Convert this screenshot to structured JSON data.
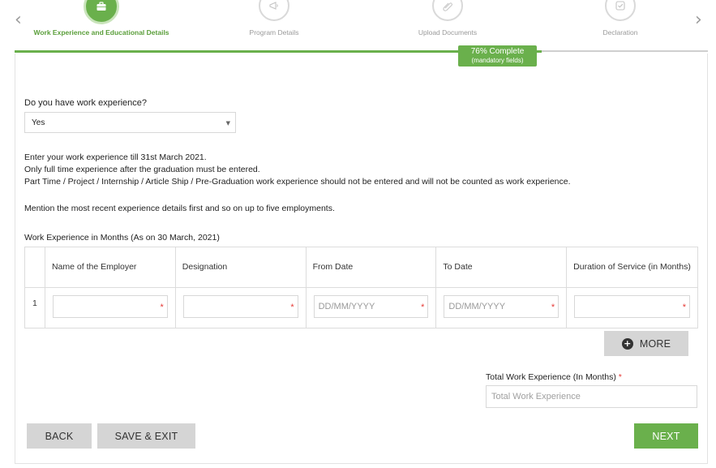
{
  "stepper": {
    "steps": [
      {
        "label": "Work Experience and Educational Details",
        "icon": "briefcase-icon",
        "active": true
      },
      {
        "label": "Program Details",
        "icon": "megaphone-icon",
        "active": false
      },
      {
        "label": "Upload Documents",
        "icon": "paperclip-icon",
        "active": false
      },
      {
        "label": "Declaration",
        "icon": "check-badge-icon",
        "active": false
      }
    ],
    "progress_percent": 76,
    "progress_label": "76% Complete",
    "progress_sub": "(mandatory fields)",
    "prev_arrow": "‹",
    "next_arrow": "›"
  },
  "form": {
    "question": "Do you have work experience?",
    "answer": "Yes",
    "caret": "▼",
    "info_lines": [
      "Enter your work experience till 31st March 2021.",
      "Only full time experience after the graduation must be entered.",
      "Part Time / Project / Internship / Article Ship / Pre-Graduation work experience should not be entered and will not be counted as work experience."
    ],
    "mention": "Mention the most recent experience details first and so on up to five employments.",
    "table_title": "Work Experience in Months (As on 30 March, 2021)",
    "columns": [
      "Name of the Employer",
      "Designation",
      "From Date",
      "To Date",
      "Duration of Service (in Months)"
    ],
    "rows": [
      {
        "num": "1",
        "from_placeholder": "DD/MM/YYYY",
        "to_placeholder": "DD/MM/YYYY"
      }
    ],
    "required_mark": "*",
    "more_label": "MORE",
    "more_icon": "+",
    "total_label": "Total Work Experience (In Months)",
    "total_placeholder": "Total Work Experience"
  },
  "buttons": {
    "back": "BACK",
    "save_exit": "SAVE & EXIT",
    "next": "NEXT"
  },
  "colors": {
    "accent_green": "#6ab04c",
    "required_red": "#e53935",
    "button_grey": "#d5d5d5"
  }
}
